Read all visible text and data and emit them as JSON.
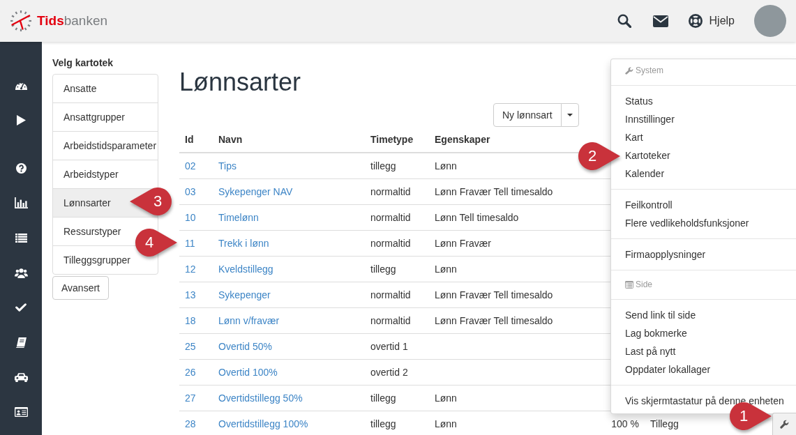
{
  "header": {
    "logo": "**Tids**banken",
    "help_link": "Hjelp"
  },
  "catalog_panel": {
    "title": "Velg kartotek",
    "items": [
      {
        "label": "Ansatte",
        "selected": false
      },
      {
        "label": "Ansattgrupper",
        "selected": false
      },
      {
        "label": "Arbeidstidsparameter",
        "selected": false
      },
      {
        "label": "Arbeidstyper",
        "selected": false
      },
      {
        "label": "Lønnsarter",
        "selected": true
      },
      {
        "label": "Ressurstyper",
        "selected": false
      },
      {
        "label": "Tilleggsgrupper",
        "selected": false
      }
    ],
    "advanced_button": "Avansert"
  },
  "page": {
    "title": "Lønnsarter",
    "new_button": "Ny lønnsart"
  },
  "table": {
    "columns": [
      "Id",
      "Navn",
      "Timetype",
      "Egenskaper"
    ],
    "rows": [
      {
        "id": "02",
        "name": "Tips",
        "time_type": "tillegg",
        "properties": "Lønn"
      },
      {
        "id": "03",
        "name": "Sykepenger NAV",
        "time_type": "normaltid",
        "properties": "Lønn Fravær Tell timesaldo"
      },
      {
        "id": "10",
        "name": "Timelønn",
        "time_type": "normaltid",
        "properties": "Lønn Tell timesaldo"
      },
      {
        "id": "11",
        "name": "Trekk i lønn",
        "time_type": "normaltid",
        "properties": "Lønn Fravær"
      },
      {
        "id": "12",
        "name": "Kveldstillegg",
        "time_type": "tillegg",
        "properties": "Lønn"
      },
      {
        "id": "13",
        "name": "Sykepenger",
        "time_type": "normaltid",
        "properties": "Lønn Fravær Tell timesaldo"
      },
      {
        "id": "18",
        "name": "Lønn v/fravær",
        "time_type": "normaltid",
        "properties": "Lønn Fravær Tell timesaldo"
      },
      {
        "id": "25",
        "name": "Overtid 50%",
        "time_type": "overtid 1"
      },
      {
        "id": "26",
        "name": "Overtid 100%",
        "time_type": "overtid 2"
      },
      {
        "id": "27",
        "name": "Overtidstillegg 50%",
        "time_type": "tillegg",
        "properties": "Lønn"
      },
      {
        "id": "28",
        "name": "Overtidstillegg 100%",
        "time_type": "tillegg",
        "properties": "Lønn",
        "column_5": "100 %",
        "column_6": "Tillegg"
      }
    ]
  },
  "menu": {
    "groups": [
      {
        "kind": "header",
        "label": "System"
      },
      {
        "kind": "items",
        "items": [
          "Status",
          "Innstillinger",
          "Kart",
          "Kartoteker",
          "Kalender"
        ]
      },
      {
        "kind": "items",
        "items": [
          "Feilkontroll",
          "Flere vedlikeholdsfunksjoner"
        ]
      },
      {
        "kind": "items",
        "items": [
          "Firmaopplysninger"
        ]
      },
      {
        "kind": "header",
        "label": "Side"
      },
      {
        "kind": "items",
        "items": [
          "Send link til side",
          "Lag bokmerke",
          "Last på nytt",
          "Oppdater lokallager"
        ]
      },
      {
        "kind": "items",
        "items": [
          "Vis skjermtastatur på denne enheten"
        ]
      }
    ]
  },
  "callouts": [
    "1",
    "2",
    "3",
    "4"
  ]
}
